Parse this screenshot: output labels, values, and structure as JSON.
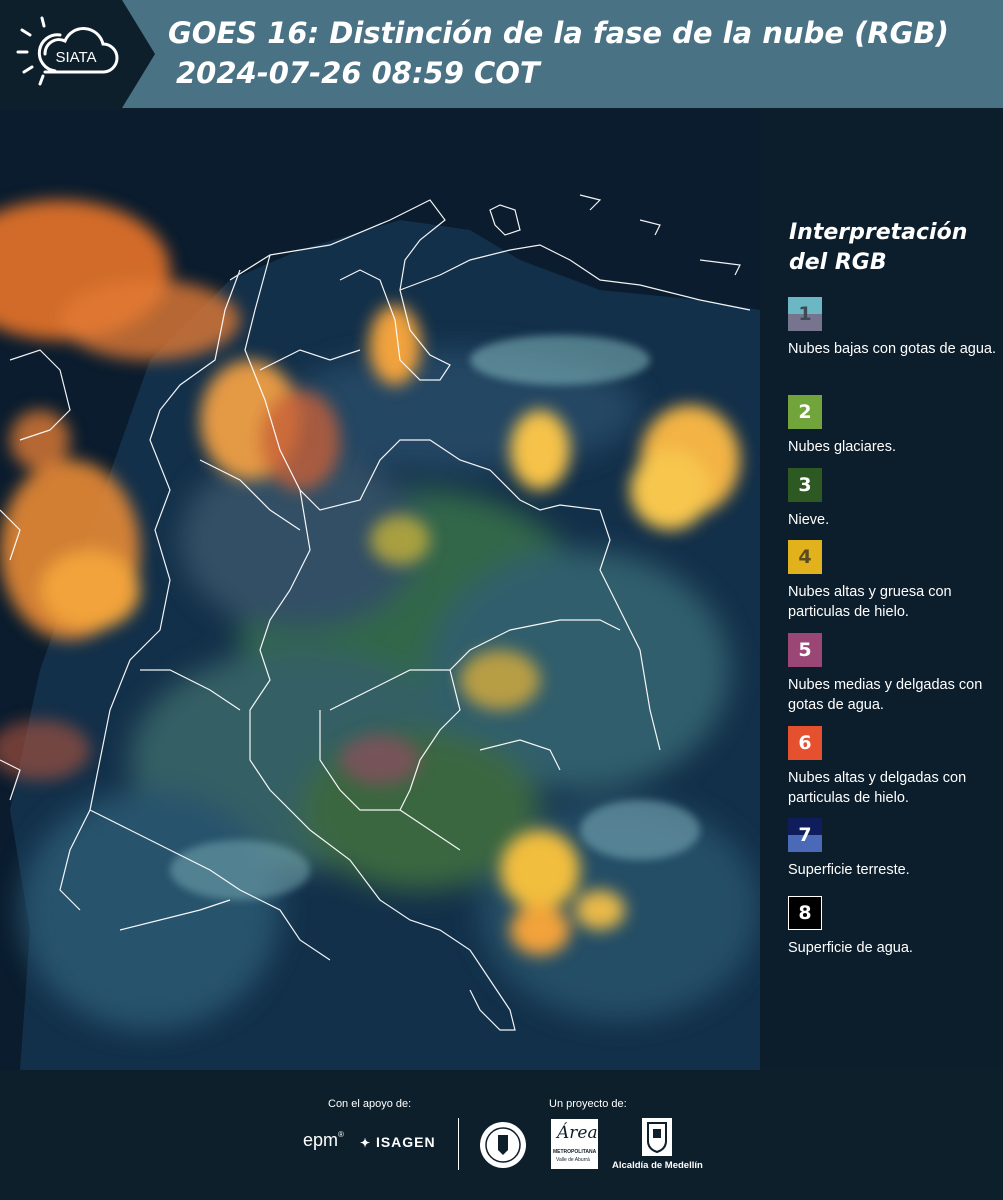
{
  "header": {
    "logo_text": "SIATA",
    "title_line1": "GOES 16: Distinción de la fase de la nube (RGB)",
    "title_line2": "2024-07-26 08:59 COT",
    "background": "#4a7285"
  },
  "map": {
    "description_icon": "satellite-rgb-map",
    "border_color": "#ffffff"
  },
  "legend": {
    "title_line1": "Interpretación",
    "title_line2": "del RGB",
    "items": [
      {
        "number": "1",
        "label": "Nubes bajas con gotas de agua.",
        "color_top": "#6bb7c4",
        "color_bottom": "#76748f",
        "number_color": "#3d4a55"
      },
      {
        "number": "2",
        "label": "Nubes glaciares.",
        "color_top": "#71a43a",
        "color_bottom": "#71a43a",
        "number_color": "#ffffff"
      },
      {
        "number": "3",
        "label": "Nieve.",
        "color_top": "#2d5a22",
        "color_bottom": "#2d5a22",
        "number_color": "#ffffff"
      },
      {
        "number": "4",
        "label": "Nubes altas y gruesa con particulas de hielo.",
        "color_top": "#e1b21c",
        "color_bottom": "#e1b21c",
        "number_color": "#5a4a20"
      },
      {
        "number": "5",
        "label": "Nubes medias y delgadas con gotas de agua.",
        "color_top": "#9a4776",
        "color_bottom": "#9a4776",
        "number_color": "#ffffff"
      },
      {
        "number": "6",
        "label": "Nubes altas y delgadas con particulas de hielo.",
        "color_top": "#e5512e",
        "color_bottom": "#e5512e",
        "number_color": "#ffffff"
      },
      {
        "number": "7",
        "label": "Superficie terreste.",
        "color_top": "#101d5c",
        "color_bottom": "#4a6ab8",
        "number_color": "#ffffff"
      },
      {
        "number": "8",
        "label": "Superficie de agua.",
        "color_top": "#000000",
        "color_bottom": "#000000",
        "number_color": "#ffffff"
      }
    ]
  },
  "footer": {
    "support_caption": "Con el apoyo de:",
    "project_caption": "Un proyecto de:",
    "epm_text": "epm",
    "isagen_text": "ISAGEN",
    "metropolitana_text": "Área",
    "metropolitana_sub": "METROPOLITANA",
    "metropolitana_sub2": "Valle de Aburrá",
    "alcaldia_text": "Alcaldía de Medellín"
  }
}
